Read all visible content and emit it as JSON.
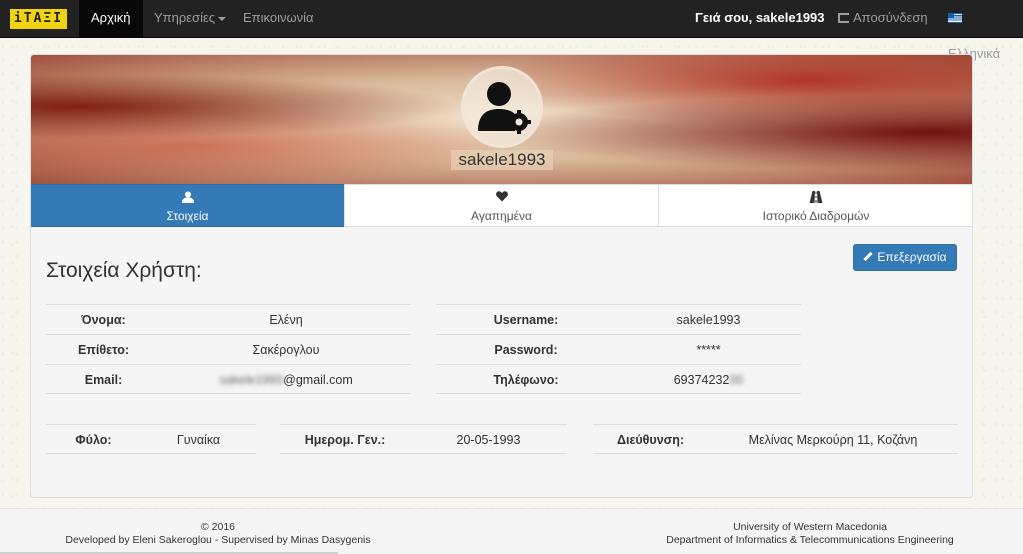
{
  "nav": {
    "brand": "iΤΑΞΙ",
    "home": "Αρχική",
    "services": "Υπηρεσίες",
    "contact": "Επικοινωνία",
    "greeting": "Γειά σου, sakele1993",
    "logout": "Αποσύνδεση",
    "language": "Ελληνικά"
  },
  "profile": {
    "username": "sakele1993"
  },
  "tabs": [
    {
      "label": "Στοιχεία",
      "icon": "user-icon"
    },
    {
      "label": "Αγαπημένα",
      "icon": "heart-icon"
    },
    {
      "label": "Ιστορικό Διαδρομών",
      "icon": "road-icon"
    }
  ],
  "edit_label": "Επεξεργασία",
  "section_title": "Στοιχεία Χρήστη:",
  "fields": {
    "first_name": {
      "label": "Όνομα:",
      "value": "Ελένη"
    },
    "last_name": {
      "label": "Επίθετο:",
      "value": "Σακέρογλου"
    },
    "email": {
      "label": "Email:",
      "value_hidden": "sakele1993",
      "value": "@gmail.com"
    },
    "username": {
      "label": "Username:",
      "value": "sakele1993"
    },
    "password": {
      "label": "Password:",
      "value": "*****"
    },
    "phone": {
      "label": "Τηλέφωνο:",
      "value": "69374232",
      "value_hidden": "00"
    },
    "gender": {
      "label": "Φύλο:",
      "value": "Γυναίκα"
    },
    "birthdate": {
      "label": "Ημερομ. Γεν.:",
      "value": "20-05-1993"
    },
    "address": {
      "label": "Διεύθυνση:",
      "value": "Μελίνας Μερκούρη 11, Κοζάνη"
    }
  },
  "footer": {
    "copyright": "© 2016",
    "developed": "Developed by Eleni Sakeroglou - Supervised by Minas Dasygenis",
    "university": "University of Western Macedonia",
    "department": "Department of Informatics & Telecommunications Engineering"
  },
  "colors": {
    "primary": "#337ab7",
    "navbar": "#222222",
    "brand": "#f1d20f"
  }
}
